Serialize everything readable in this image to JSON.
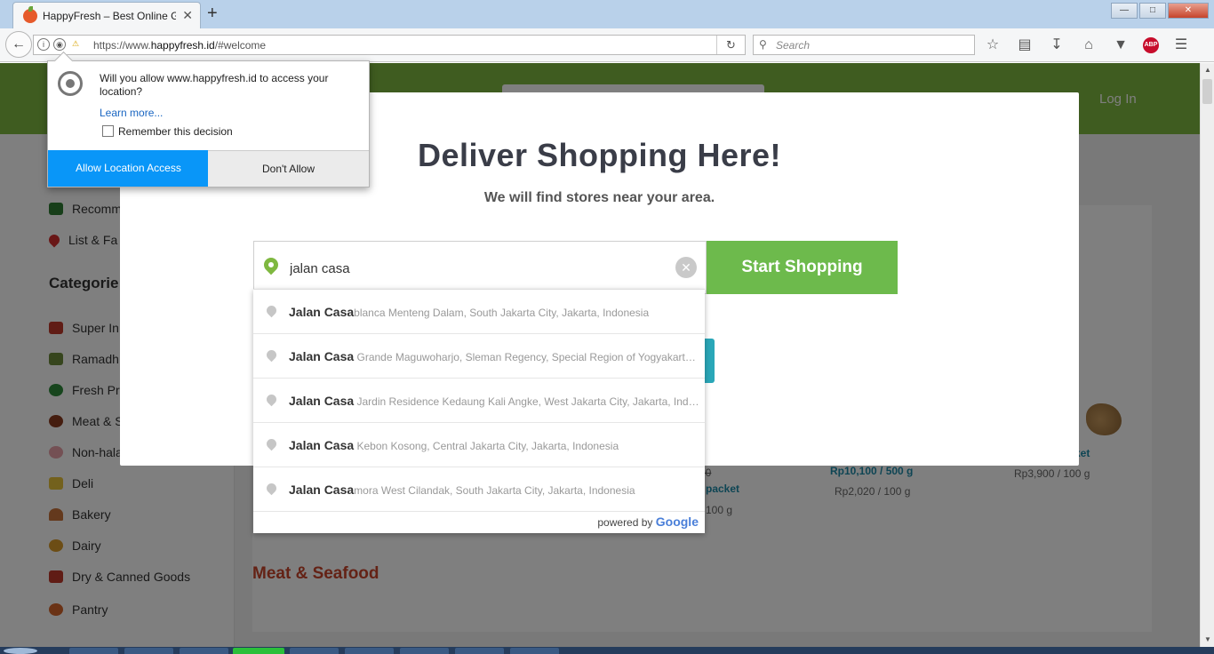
{
  "browser": {
    "tab_title": "HappyFresh – Best Online Gr",
    "tab_close": "✕",
    "new_tab": "+",
    "url_prefix": "https://www.",
    "url_domain": "happyfresh.id",
    "url_path": "/#welcome",
    "search_placeholder": "Search",
    "back_glyph": "←",
    "reload_glyph": "↻",
    "win_min": "—",
    "win_max": "□",
    "win_close": "✕",
    "abp_label": "ABP",
    "icons": [
      "star-icon",
      "reading-list-icon",
      "download-icon",
      "home-icon",
      "pocket-icon",
      "adblock-icon",
      "menu-icon"
    ]
  },
  "header": {
    "login": "Log In"
  },
  "sidebar": {
    "top_items": [
      {
        "label": "Recomm",
        "icon_color": "#2e7d32"
      },
      {
        "label": "List & Fa",
        "icon_color": "#d32f2f"
      }
    ],
    "categories_title": "Categorie",
    "categories": [
      {
        "label": "Super In",
        "icon_color": "#c0392b"
      },
      {
        "label": "Ramadh",
        "icon_color": "#6d8b3a"
      },
      {
        "label": "Fresh Pr",
        "icon_color": "#2e8b3a"
      },
      {
        "label": "Meat & S",
        "icon_color": "#8b3a1e"
      },
      {
        "label": "Non-hala",
        "icon_color": "#e8a0a8"
      },
      {
        "label": "Deli",
        "icon_color": "#e6c23a"
      },
      {
        "label": "Bakery",
        "icon_color": "#c8733a"
      },
      {
        "label": "Dairy",
        "icon_color": "#d89a2a"
      },
      {
        "label": "Dry & Canned Goods",
        "icon_color": "#c0392b"
      },
      {
        "label": "Pantry",
        "icon_color": "#d4652a"
      }
    ]
  },
  "products": {
    "price_a_strike": "90",
    "price_a_unit": "packet",
    "price_a_per": "100 g",
    "price_b_main": "Rp10,100 / 500 g",
    "price_b_per": "Rp2,020 / 100 g",
    "price_c_unit": "ket",
    "price_c_per": "Rp3,900 / 100 g",
    "section_title": "Meat & Seafood"
  },
  "modal": {
    "title": "Deliver Shopping Here!",
    "subtitle": "We will find stores near your area.",
    "address_value": "jalan casa",
    "clear_glyph": "✕",
    "start_button": "Start Shopping"
  },
  "suggestions": [
    {
      "match": "Jalan Casa",
      "rest": "blanca Menteng Dalam, South Jakarta City, Jakarta, Indonesia"
    },
    {
      "match": "Jalan Casa",
      "rest": " Grande Maguwoharjo, Sleman Regency, Special Region of Yogyakarta, Indonesia"
    },
    {
      "match": "Jalan Casa",
      "rest": " Jardin Residence Kedaung Kali Angke, West Jakarta City, Jakarta, Indonesia"
    },
    {
      "match": "Jalan Casa",
      "rest": " Kebon Kosong, Central Jakarta City, Jakarta, Indonesia"
    },
    {
      "match": "Jalan Casa",
      "rest": "mora West Cilandak, South Jakarta City, Jakarta, Indonesia"
    }
  ],
  "powered_by": {
    "prefix": "powered by",
    "brand": "Google"
  },
  "permission": {
    "question": "Will you allow www.happyfresh.id to access your location?",
    "learn_more": "Learn more...",
    "remember": "Remember this decision",
    "allow": "Allow Location Access",
    "deny": "Don't Allow"
  },
  "colors": {
    "brand_green": "#7fb840",
    "button_green": "#6dba4c",
    "accent_blue": "#0996f8",
    "price_teal": "#1c8aa8",
    "section_red": "#c8442b"
  }
}
